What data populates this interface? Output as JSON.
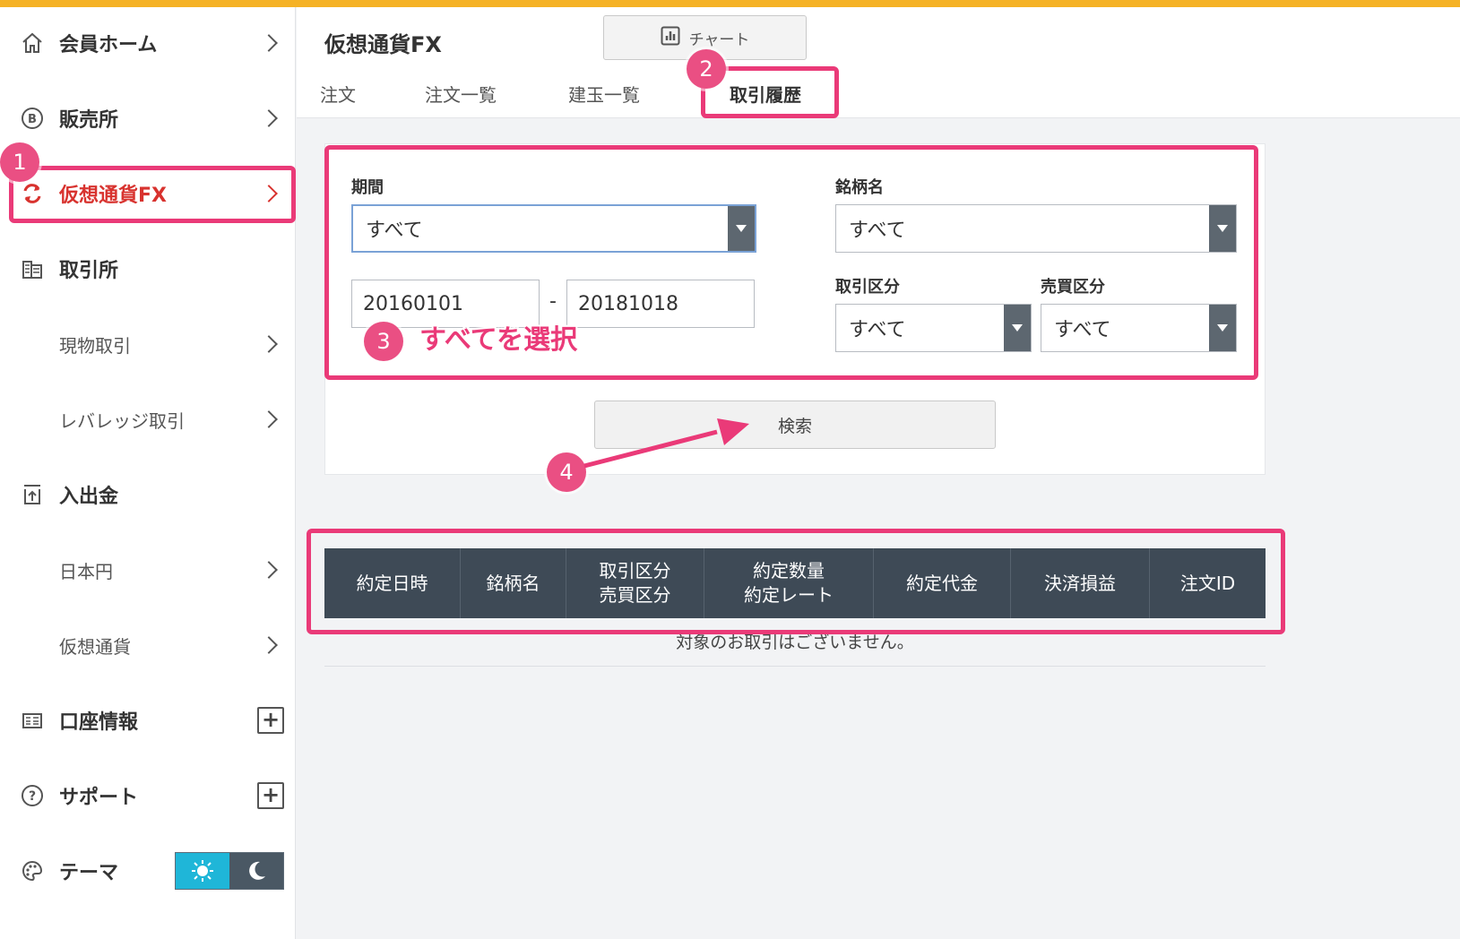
{
  "sidebar": {
    "items": [
      {
        "label": "会員ホーム",
        "icon": "home-icon"
      },
      {
        "label": "販売所",
        "icon": "bitcoin-icon"
      },
      {
        "label": "仮想通貨FX",
        "icon": "exchange-icon",
        "active": true
      },
      {
        "label": "取引所",
        "icon": "building-icon"
      },
      {
        "label": "現物取引",
        "sub": true
      },
      {
        "label": "レバレッジ取引",
        "sub": true
      },
      {
        "label": "入出金",
        "icon": "upload-icon"
      },
      {
        "label": "日本円",
        "sub": true
      },
      {
        "label": "仮想通貨",
        "sub": true
      },
      {
        "label": "口座情報",
        "icon": "account-icon"
      },
      {
        "label": "サポート",
        "icon": "help-icon"
      },
      {
        "label": "テーマ",
        "icon": "palette-icon"
      }
    ],
    "plus": "+"
  },
  "header": {
    "title": "仮想通貨FX",
    "chart_button": "チャート",
    "tabs": [
      "注文",
      "注文一覧",
      "建玉一覧",
      "取引履歴"
    ],
    "active_tab": "取引履歴"
  },
  "filters": {
    "period_label": "期間",
    "period_value": "すべて",
    "symbol_label": "銘柄名",
    "symbol_value": "すべて",
    "date_from": "20160101",
    "date_sep": "-",
    "date_to": "20181018",
    "trade_type_label": "取引区分",
    "trade_type_value": "すべて",
    "side_label": "売買区分",
    "side_value": "すべて",
    "search_button": "検索"
  },
  "table": {
    "headers": [
      [
        "約定日時"
      ],
      [
        "銘柄名"
      ],
      [
        "取引区分",
        "売買区分"
      ],
      [
        "約定数量",
        "約定レート"
      ],
      [
        "約定代金"
      ],
      [
        "決済損益"
      ],
      [
        "注文ID"
      ]
    ],
    "empty_message": "対象のお取引はございません。"
  },
  "annotations": {
    "steps": [
      "1",
      "2",
      "3",
      "4"
    ],
    "step3_text": "すべてを選択"
  },
  "colors": {
    "accent": "#d8332f",
    "annotation": "#ea3a78",
    "topbar": "#f5b225",
    "table_header": "#3e4a56",
    "theme_light": "#1fb6d8"
  }
}
